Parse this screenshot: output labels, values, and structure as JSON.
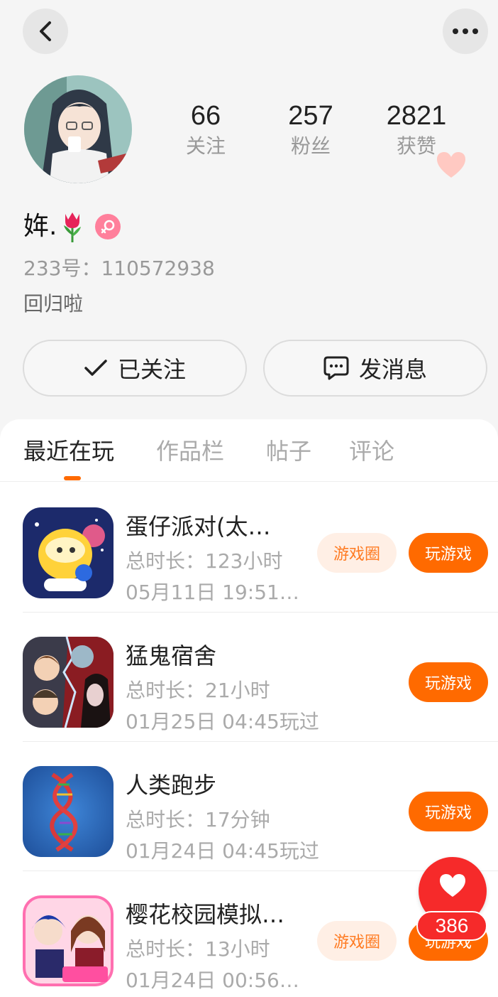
{
  "profile": {
    "stats": [
      {
        "value": "66",
        "label": "关注"
      },
      {
        "value": "257",
        "label": "粉丝"
      },
      {
        "value": "2821",
        "label": "获赞"
      }
    ],
    "nickname": "姩.",
    "nickname_emoji": "tulip-icon",
    "gender": "female",
    "uid": "233号：110572938",
    "bio": "回归啦"
  },
  "actions": {
    "follow_label": "已关注",
    "message_label": "发消息"
  },
  "tabs": [
    {
      "label": "最近在玩",
      "active": true
    },
    {
      "label": "作品栏",
      "active": false
    },
    {
      "label": "帖子",
      "active": false
    },
    {
      "label": "评论",
      "active": false
    }
  ],
  "games": [
    {
      "title": "蛋仔派对(太…",
      "duration": "总时长：123小时",
      "last_played": "05月11日 19:51…",
      "has_circle": true
    },
    {
      "title": "猛鬼宿舍",
      "duration": "总时长：21小时",
      "last_played": "01月25日 04:45玩过",
      "has_circle": false
    },
    {
      "title": "人类跑步",
      "duration": "总时长：17分钟",
      "last_played": "01月24日 04:45玩过",
      "has_circle": false
    },
    {
      "title": "樱花校园模拟…",
      "duration": "总时长：13小时",
      "last_played": "01月24日 00:56…",
      "has_circle": true
    }
  ],
  "buttons": {
    "circle_label": "游戏圈",
    "play_label": "玩游戏"
  },
  "floating_like": {
    "count": "386"
  },
  "colors": {
    "accent": "#ff6a00",
    "like_red": "#f62a2a",
    "gender_pink": "#ff7f9b"
  }
}
